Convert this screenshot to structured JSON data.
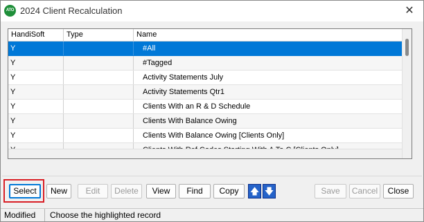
{
  "window": {
    "title": "2024 Client Recalculation",
    "icon_text": "ATO",
    "close_glyph": "✕"
  },
  "grid": {
    "columns": [
      "HandiSoft",
      "Type",
      "Name"
    ],
    "rows": [
      {
        "handisoft": "Y",
        "type": "",
        "name": "#All",
        "selected": true
      },
      {
        "handisoft": "Y",
        "type": "",
        "name": "#Tagged"
      },
      {
        "handisoft": "Y",
        "type": "",
        "name": "Activity Statements July"
      },
      {
        "handisoft": "Y",
        "type": "",
        "name": "Activity Statements Qtr1"
      },
      {
        "handisoft": "Y",
        "type": "",
        "name": "Clients With an R & D Schedule"
      },
      {
        "handisoft": "Y",
        "type": "",
        "name": "Clients With Balance Owing"
      },
      {
        "handisoft": "Y",
        "type": "",
        "name": "Clients With Balance Owing [Clients Only]"
      },
      {
        "handisoft": "Y",
        "type": "",
        "name": "Clients With Ref Codes Starting With A To C [Clients Only]"
      }
    ]
  },
  "toolbar": {
    "select": "Select",
    "new": "New",
    "edit": "Edit",
    "delete": "Delete",
    "view": "View",
    "find": "Find",
    "copy": "Copy",
    "up_icon": "arrow-up-icon",
    "down_icon": "arrow-down-icon",
    "up_glyph": "🡅",
    "down_glyph": "🡇",
    "save": "Save",
    "cancel": "Cancel",
    "close": "Close"
  },
  "status": {
    "mode": "Modified",
    "message": "Choose the highlighted record"
  },
  "colors": {
    "selection": "#0078d7",
    "highlight_box": "#d91e25",
    "arrow_button": "#2563c9",
    "app_icon": "#1f8f3a"
  }
}
